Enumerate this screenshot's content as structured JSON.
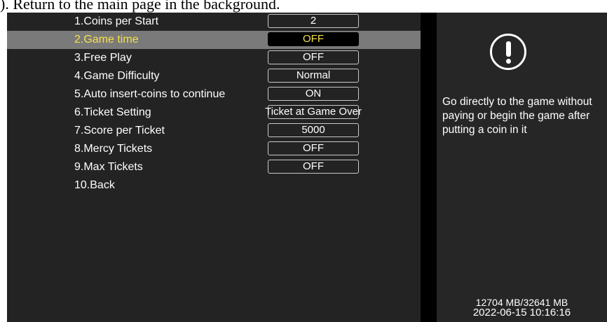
{
  "caption": "). Return to the main page in the background.",
  "menu": {
    "items": [
      {
        "label": "1.Coins per Start",
        "value": "2"
      },
      {
        "label": "2.Game time",
        "value": "OFF"
      },
      {
        "label": "3.Free Play",
        "value": "OFF"
      },
      {
        "label": "4.Game Difficulty",
        "value": "Normal"
      },
      {
        "label": "5.Auto insert-coins to continue",
        "value": "ON"
      },
      {
        "label": "6.Ticket Setting",
        "value": "Ticket at Game Over"
      },
      {
        "label": "7.Score per Ticket",
        "value": "5000"
      },
      {
        "label": "8.Mercy Tickets",
        "value": "OFF"
      },
      {
        "label": "9.Max Tickets",
        "value": "OFF"
      },
      {
        "label": "10.Back"
      }
    ],
    "selected_index": 1,
    "highlight_color": "#f5e04a"
  },
  "info": {
    "icon": "exclamation-circle-icon",
    "help_text": "Go directly to the game without paying or begin the game after putting a coin in it",
    "storage": "12704 MB/32641 MB",
    "datetime": "2022-06-15 10:16:16"
  }
}
